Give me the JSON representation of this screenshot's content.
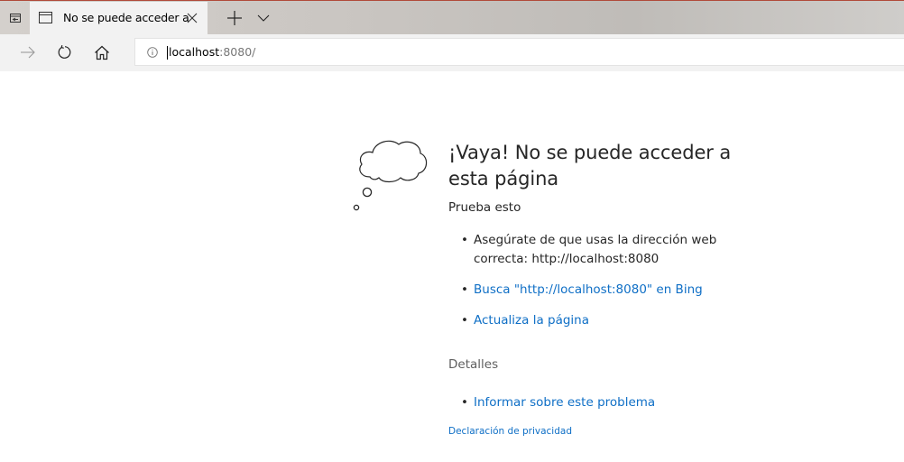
{
  "browser": {
    "tab": {
      "title": "No se puede acceder a"
    },
    "address_bar": {
      "host": "localhost",
      "port": ":8080/"
    }
  },
  "icons": {
    "tab_aside": "tab-aside-icon",
    "tab_favicon": "page-icon",
    "tab_close": "close-icon",
    "new_tab": "plus-icon",
    "tab_list": "chevron-down-icon",
    "back": "arrow-right-icon",
    "refresh": "refresh-icon",
    "home": "home-icon",
    "site_info": "info-icon",
    "illustration": "thought-cloud-icon"
  },
  "error_page": {
    "title": "¡Vaya! No se puede acceder a esta página",
    "try_heading": "Prueba esto",
    "suggestions": [
      "Asegúrate de que usas la dirección web correcta: http://localhost:8080",
      "Busca \"http://localhost:8080\" en Bing",
      "Actualiza la página"
    ],
    "details_heading": "Detalles",
    "details_link": "Informar sobre este problema",
    "privacy_link": "Declaración de privacidad"
  },
  "colors": {
    "link": "#0f6fc6",
    "text": "#262626",
    "chrome_bg": "#f2f2f2"
  }
}
